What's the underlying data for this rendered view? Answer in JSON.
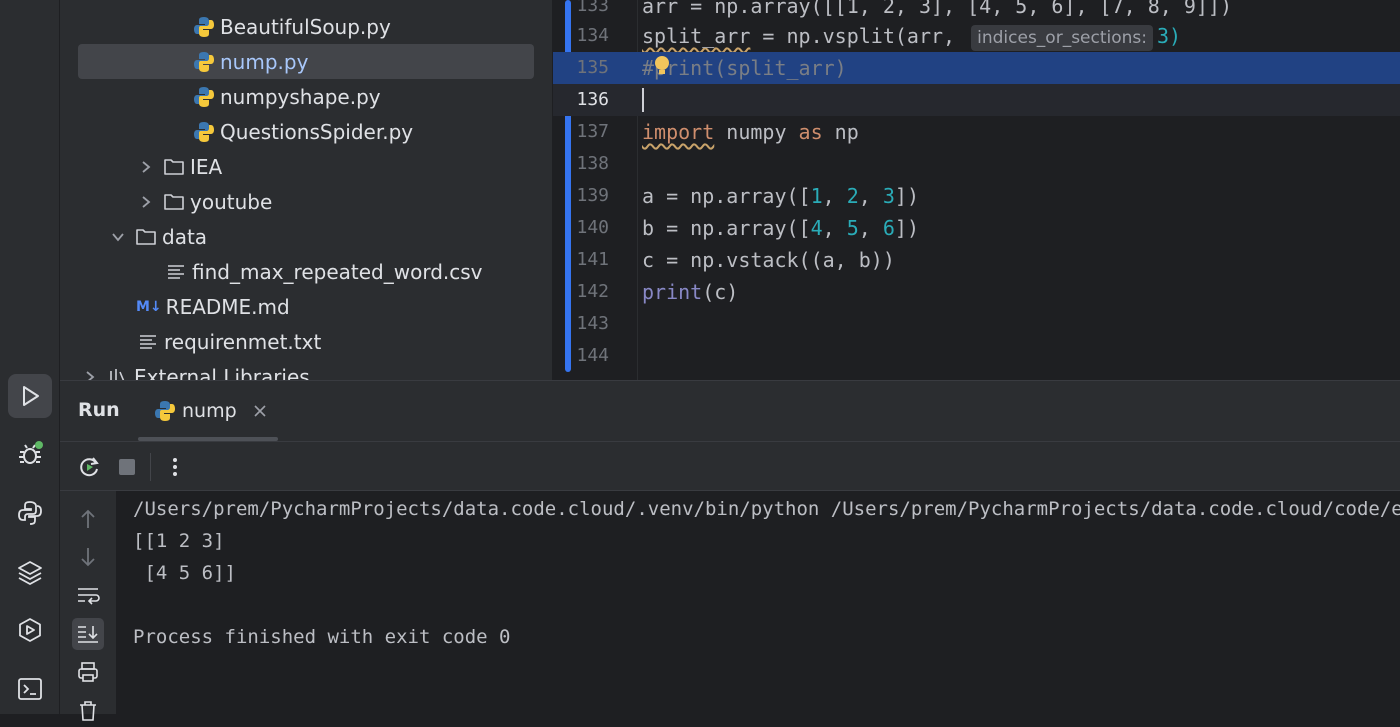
{
  "project_tree": {
    "items": [
      {
        "label": "BeautifulSoup.py",
        "type": "python"
      },
      {
        "label": "nump.py",
        "type": "python",
        "selected": true
      },
      {
        "label": "numpyshape.py",
        "type": "python"
      },
      {
        "label": "QuestionsSpider.py",
        "type": "python"
      },
      {
        "label": "IEA",
        "type": "folder"
      },
      {
        "label": "youtube",
        "type": "folder"
      },
      {
        "label": "data",
        "type": "folder-open"
      },
      {
        "label": "find_max_repeated_word.csv",
        "type": "text"
      },
      {
        "label": "README.md",
        "type": "markdown"
      },
      {
        "label": "requirenmet.txt",
        "type": "text"
      },
      {
        "label": "External Libraries",
        "type": "library"
      }
    ],
    "md_badge": "M↓"
  },
  "editor": {
    "line_numbers": [
      "133",
      "134",
      "135",
      "136",
      "137",
      "138",
      "139",
      "140",
      "141",
      "142",
      "143",
      "144"
    ],
    "code": {
      "l133": "arr = np.array([[1, 2, 3], [4, 5, 6], [7, 8, 9]])",
      "l134_a": "split_arr",
      "l134_b": " = np.vsplit(arr, ",
      "l134_hint": "indices_or_sections:",
      "l134_c": "3)",
      "l135_a": "#",
      "l135_b": "print(split_arr)",
      "l137_kw1": "import",
      "l137_mid": " numpy ",
      "l137_kw2": "as",
      "l137_end": " np",
      "l139_a": "a = np.array([",
      "l139_n1": "1",
      "l139_n2": "2",
      "l139_n3": "3",
      "l140_a": "b = np.array([",
      "l140_n1": "4",
      "l140_n2": "5",
      "l140_n3": "6",
      "l141": "c = np.vstack((a, b))",
      "l142_fn": "print",
      "l142_rest": "(c)"
    }
  },
  "run_panel": {
    "title": "Run",
    "tab_label": "nump",
    "console_lines": [
      "/Users/prem/PycharmProjects/data.code.cloud/.venv/bin/python /Users/prem/PycharmProjects/data.code.cloud/code/e",
      "[[1 2 3]",
      " [4 5 6]]",
      "",
      "Process finished with exit code 0"
    ]
  },
  "colors": {
    "accent": "#3574f0",
    "selection": "#214283",
    "keyword": "#cf8e6d",
    "number": "#2aacb8",
    "python_blue": "#3b77b0",
    "python_yellow": "#f5c83b"
  }
}
